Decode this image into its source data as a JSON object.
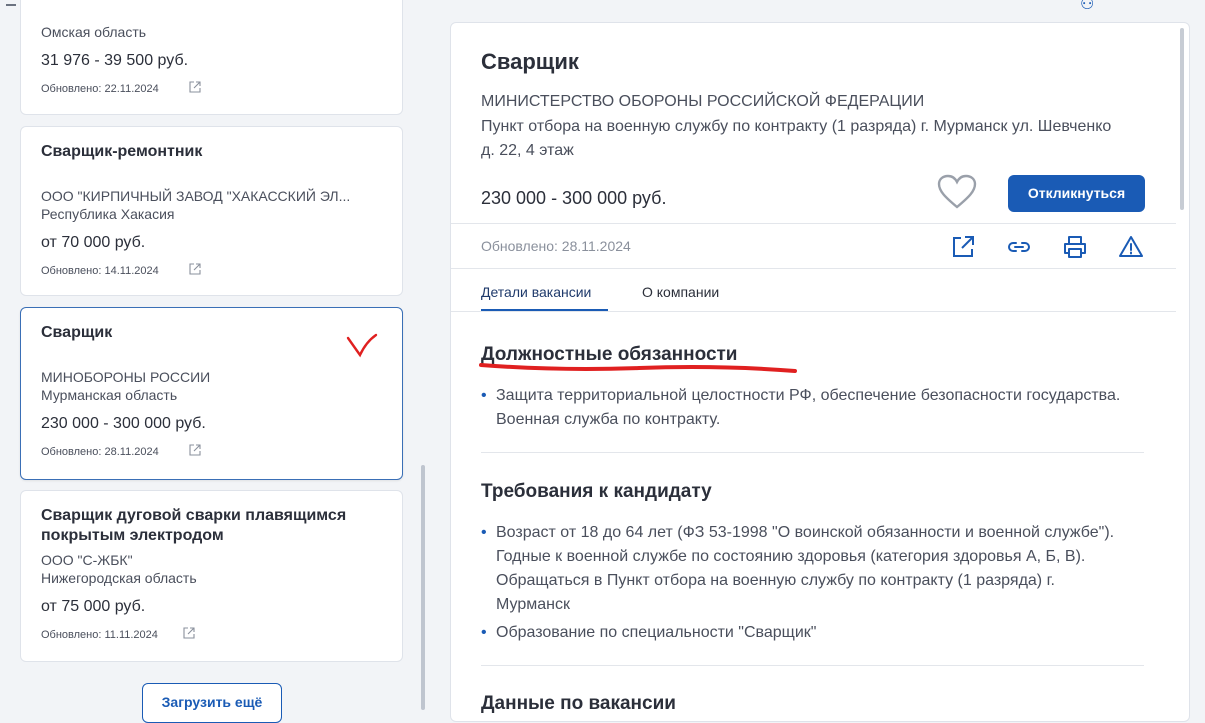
{
  "vacancies": [
    {
      "title": "",
      "company": "",
      "region": "Омская область",
      "salary": "31 976 - 39 500 руб.",
      "updated": "Обновлено: 22.11.2024"
    },
    {
      "title": "Сварщик-ремонтник",
      "company": "ООО \"КИРПИЧНЫЙ ЗАВОД \"ХАКАССКИЙ ЭЛ...",
      "region": "Республика Хакасия",
      "salary": "от 70 000 руб.",
      "updated": "Обновлено: 14.11.2024"
    },
    {
      "title": "Сварщик",
      "company": "МИНОБОРОНЫ РОССИИ",
      "region": "Мурманская область",
      "salary": "230 000 - 300 000 руб.",
      "updated": "Обновлено: 28.11.2024"
    },
    {
      "title": "Сварщик дуговой сварки плавящимся покрытым электродом",
      "company": "ООО \"С-ЖБК\"",
      "region": "Нижегородская область",
      "salary": "от 75 000 руб.",
      "updated": "Обновлено: 11.11.2024"
    }
  ],
  "load_more_label": "Загрузить ещё",
  "detail": {
    "title": "Сварщик",
    "organization": "МИНИСТЕРСТВО ОБОРОНЫ РОССИЙСКОЙ ФЕДЕРАЦИИ",
    "address": "Пункт отбора на военную службу по контракту (1 разряда) г. Мурманск ул. Шевченко д. 22, 4 этаж",
    "salary": "230 000 - 300 000 руб.",
    "apply_label": "Откликнуться",
    "updated": "Обновлено: 28.11.2024",
    "tabs": [
      "Детали вакансии",
      "О компании"
    ],
    "sections": [
      {
        "title": "Должностные обязанности",
        "items": [
          "Защита территориальной целостности РФ, обеспечение безопасности государства. Военная служба по контракту."
        ]
      },
      {
        "title": "Требования к кандидату",
        "items": [
          "Возраст от 18 до 64 лет (ФЗ 53-1998 \"О воинской обязанности и военной службе\"). Годные к военной службе по состоянию здоровья (категория здоровья А, Б, В). Обращаться в Пункт отбора на военную службу по контракту (1 разряда) г. Мурманск",
          "Образование по специальности \"Сварщик\""
        ]
      },
      {
        "title": "Данные по вакансии",
        "items": []
      }
    ]
  },
  "colors": {
    "accent": "#1a5bb5",
    "annotation": "#e02020"
  },
  "icons": [
    "external-link-icon",
    "heart-icon",
    "link-icon",
    "print-icon",
    "warning-icon"
  ]
}
